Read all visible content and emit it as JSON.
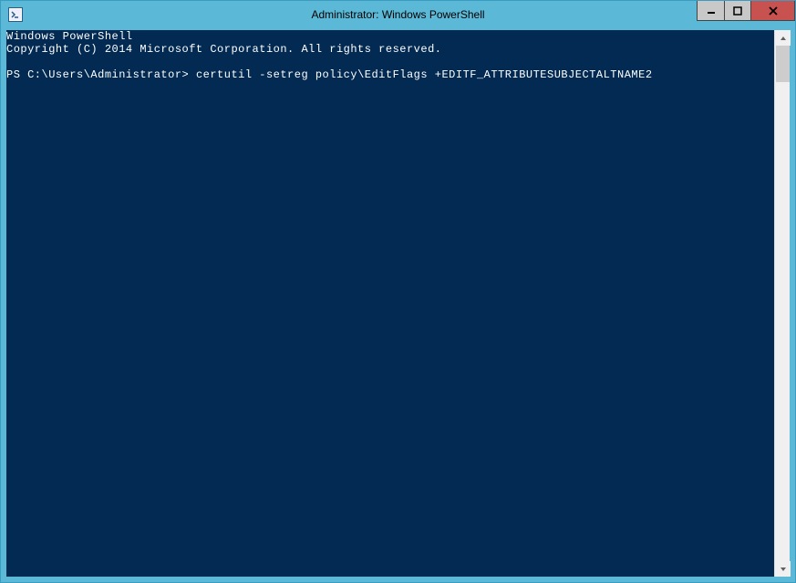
{
  "titlebar": {
    "title": "Administrator: Windows PowerShell"
  },
  "console": {
    "line1": "Windows PowerShell",
    "line2": "Copyright (C) 2014 Microsoft Corporation. All rights reserved.",
    "prompt": "PS C:\\Users\\Administrator>",
    "command": "certutil -setreg policy\\EditFlags +EDITF_ATTRIBUTESUBJECTALTNAME2"
  },
  "icons": {
    "minimize": "—",
    "maximize": "▢",
    "close": "✕"
  }
}
